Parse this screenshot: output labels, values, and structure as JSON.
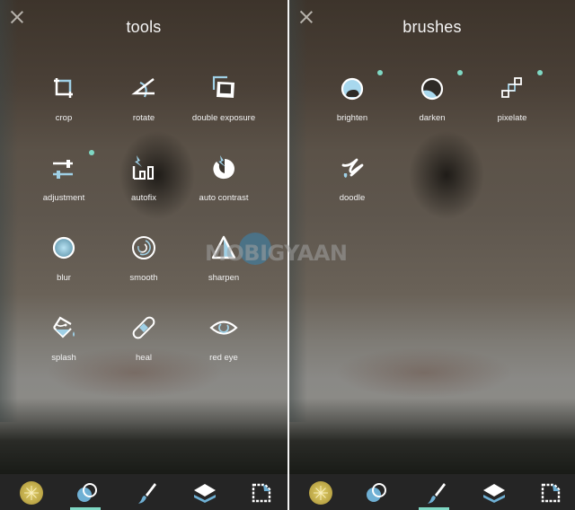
{
  "left_panel": {
    "title": "tools",
    "close_icon": "close-icon",
    "items": [
      {
        "label": "crop",
        "icon": "crop-icon",
        "new": false
      },
      {
        "label": "rotate",
        "icon": "rotate-icon",
        "new": false
      },
      {
        "label": "double exposure",
        "icon": "double-exposure-icon",
        "new": false
      },
      {
        "label": "adjustment",
        "icon": "adjustment-icon",
        "new": true
      },
      {
        "label": "autofix",
        "icon": "autofix-icon",
        "new": false
      },
      {
        "label": "auto contrast",
        "icon": "auto-contrast-icon",
        "new": false
      },
      {
        "label": "blur",
        "icon": "blur-icon",
        "new": false
      },
      {
        "label": "smooth",
        "icon": "smooth-icon",
        "new": false
      },
      {
        "label": "sharpen",
        "icon": "sharpen-icon",
        "new": false
      },
      {
        "label": "splash",
        "icon": "splash-icon",
        "new": false
      },
      {
        "label": "heal",
        "icon": "heal-icon",
        "new": false
      },
      {
        "label": "red eye",
        "icon": "red-eye-icon",
        "new": false
      }
    ],
    "bottom_nav": {
      "active": "tools"
    }
  },
  "right_panel": {
    "title": "brushes",
    "close_icon": "close-icon",
    "items": [
      {
        "label": "brighten",
        "icon": "brighten-icon",
        "new": true
      },
      {
        "label": "darken",
        "icon": "darken-icon",
        "new": true
      },
      {
        "label": "pixelate",
        "icon": "pixelate-icon",
        "new": true
      },
      {
        "label": "doodle",
        "icon": "doodle-icon",
        "new": false
      }
    ],
    "bottom_nav": {
      "active": "brushes"
    }
  },
  "bottom_nav_items": [
    {
      "name": "effects",
      "icon": "effects-icon"
    },
    {
      "name": "tools",
      "icon": "tools-icon"
    },
    {
      "name": "brushes",
      "icon": "brush-icon"
    },
    {
      "name": "layers",
      "icon": "layers-icon"
    },
    {
      "name": "stickers",
      "icon": "sticker-icon"
    }
  ],
  "watermark": {
    "text": "MOBIGYAAN"
  },
  "colors": {
    "accent": "#7fd8c4",
    "icon_blue": "#9fd0e6",
    "icon_white": "#ffffff",
    "bar_bg": "#252525"
  }
}
